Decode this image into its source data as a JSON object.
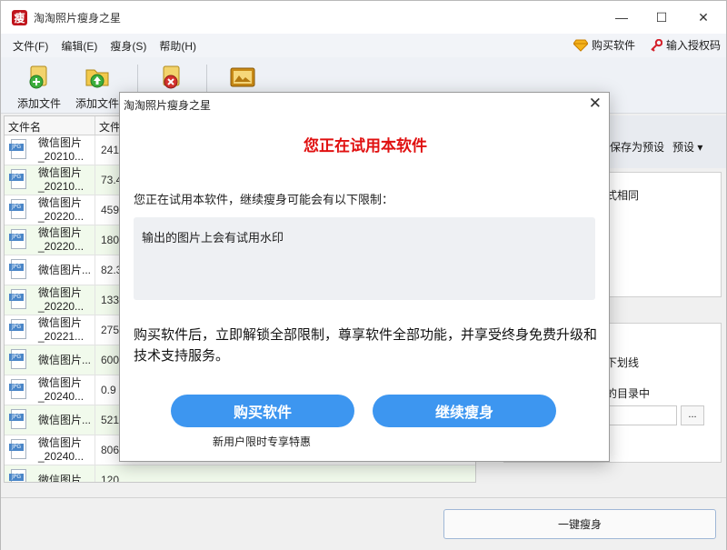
{
  "window": {
    "title": "淘淘照片瘦身之星",
    "app_icon_glyph": "瘦",
    "minimize_icon": "—",
    "maximize_icon": "☐",
    "close_icon": "✕"
  },
  "menu": {
    "items": [
      "文件(F)",
      "编辑(E)",
      "瘦身(S)",
      "帮助(H)"
    ],
    "buy": "购买软件",
    "license": "输入授权码"
  },
  "toolbar": {
    "add_file": "添加文件",
    "add_folder": "添加文件"
  },
  "table": {
    "headers": [
      "文件名",
      "文件"
    ],
    "rows": [
      {
        "name1": "微信图片",
        "name2": "_20210...",
        "size": "241"
      },
      {
        "name1": "微信图片",
        "name2": "_20210...",
        "size": "73.4"
      },
      {
        "name1": "微信图片",
        "name2": "_20220...",
        "size": "459"
      },
      {
        "name1": "微信图片",
        "name2": "_20220...",
        "size": "180"
      },
      {
        "name1": "微信图片...",
        "name2": "",
        "size": "82.3"
      },
      {
        "name1": "微信图片",
        "name2": "_20220...",
        "size": "133"
      },
      {
        "name1": "微信图片",
        "name2": "_20221...",
        "size": "275"
      },
      {
        "name1": "微信图片...",
        "name2": "",
        "size": "600"
      },
      {
        "name1": "微信图片",
        "name2": "_20240...",
        "size": "0.9"
      },
      {
        "name1": "微信图片...",
        "name2": "",
        "size": "521"
      },
      {
        "name1": "微信图片",
        "name2": "_20240...",
        "size": "806"
      },
      {
        "name1": "微信图片",
        "name2": "",
        "size": "120 KB"
      }
    ],
    "file_tag": "JPG"
  },
  "right_panel": {
    "save_preset": "保存为预设",
    "preset": "预设",
    "same_text": "式相同",
    "underline_text": "下划线",
    "dir_text": "的目录中",
    "browse": "..."
  },
  "bottom": {
    "one_click": "一键瘦身"
  },
  "dialog": {
    "title": "淘淘照片瘦身之星",
    "close": "✕",
    "heading": "您正在试用本软件",
    "lead": "您正在试用本软件，继续瘦身可能会有以下限制：",
    "limitation": "输出的图片上会有试用水印",
    "paragraph": "购买软件后，立即解锁全部限制，尊享软件全部功能，并享受终身免费升级和技术支持服务。",
    "buy_button": "购买软件",
    "continue_button": "继续瘦身",
    "note": "新用户限时专享特惠"
  },
  "colors": {
    "heading_red": "#e01010",
    "button_blue": "#3d96f0",
    "row_green": "#f1faec"
  }
}
